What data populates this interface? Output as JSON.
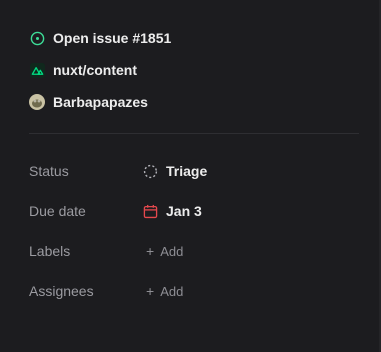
{
  "issue": {
    "label": "Open issue #1851",
    "icon": "issue-open-icon",
    "icon_color": "#3ddc97"
  },
  "repo": {
    "label": "nuxt/content",
    "icon": "nuxt-logo-icon",
    "icon_color": "#00dc82"
  },
  "author": {
    "label": "Barbapapazes",
    "icon": "avatar"
  },
  "properties": {
    "status": {
      "label": "Status",
      "value": "Triage",
      "icon": "triage-dashed-circle-icon"
    },
    "due_date": {
      "label": "Due date",
      "value": "Jan 3",
      "icon": "calendar-icon",
      "icon_color": "#e5484d"
    },
    "labels": {
      "label": "Labels",
      "add_label": "Add"
    },
    "assignees": {
      "label": "Assignees",
      "add_label": "Add"
    }
  }
}
